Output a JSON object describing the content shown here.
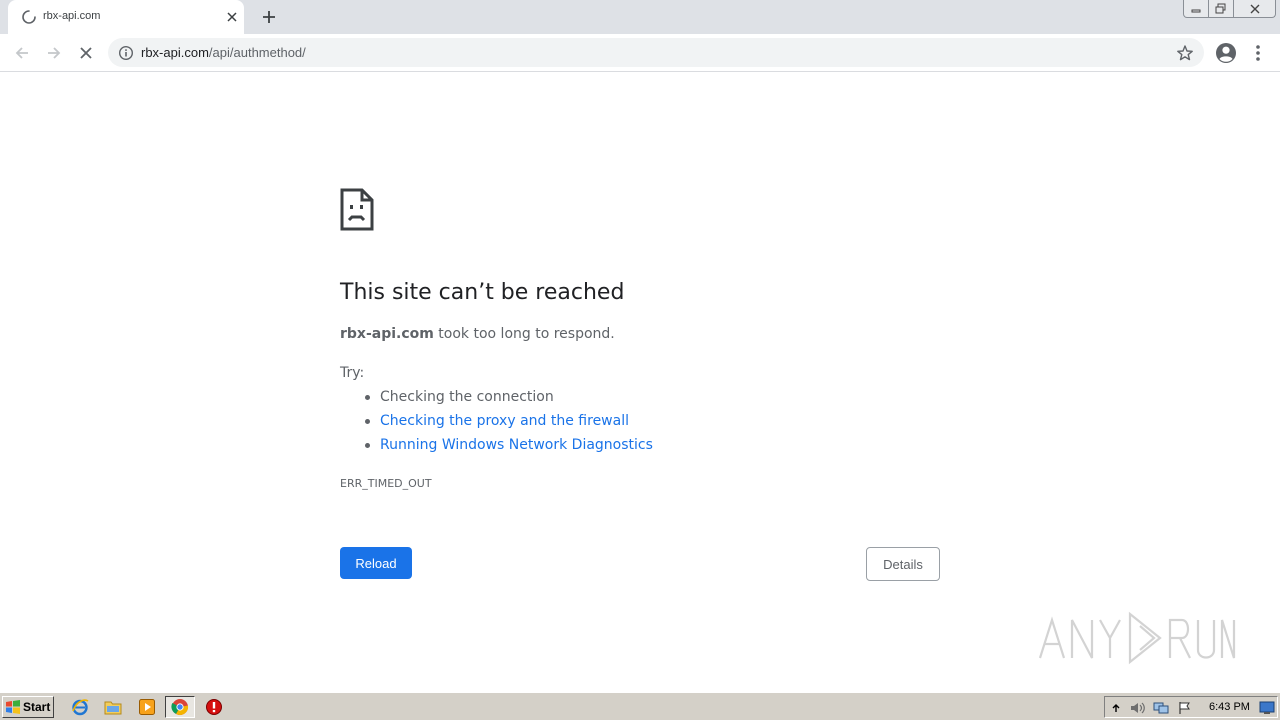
{
  "browser": {
    "tab": {
      "title": "rbx-api.com"
    },
    "address_bar": {
      "host": "rbx-api.com",
      "path": "/api/authmethod/"
    }
  },
  "error_page": {
    "heading": "This site can’t be reached",
    "summary_host": "rbx-api.com",
    "summary_text": " took too long to respond.",
    "try_label": "Try:",
    "suggestions": [
      {
        "text": "Checking the connection",
        "link": false
      },
      {
        "text": "Checking the proxy and the firewall",
        "link": true
      },
      {
        "text": "Running Windows Network Diagnostics",
        "link": true
      }
    ],
    "error_code": "ERR_TIMED_OUT",
    "reload_label": "Reload",
    "details_label": "Details"
  },
  "taskbar": {
    "start_label": "Start",
    "clock": "6:43 PM"
  },
  "colors": {
    "accent": "#1a73e8",
    "text_primary": "#202124",
    "text_secondary": "#5f6368",
    "tab_strip": "#dee1e6",
    "taskbar": "#d4d0c8"
  },
  "icons": {
    "tab": [
      "loading-spinner-icon",
      "close-icon",
      "plus-icon"
    ],
    "toolbar": [
      "back-arrow-icon",
      "forward-arrow-icon",
      "stop-icon",
      "info-icon",
      "star-icon",
      "profile-icon",
      "kebab-menu-icon"
    ],
    "page": [
      "sad-page-icon"
    ],
    "taskbar": [
      "windows-logo-icon",
      "ie-icon",
      "folder-icon",
      "media-player-icon",
      "chrome-icon",
      "stop-sign-icon"
    ]
  }
}
